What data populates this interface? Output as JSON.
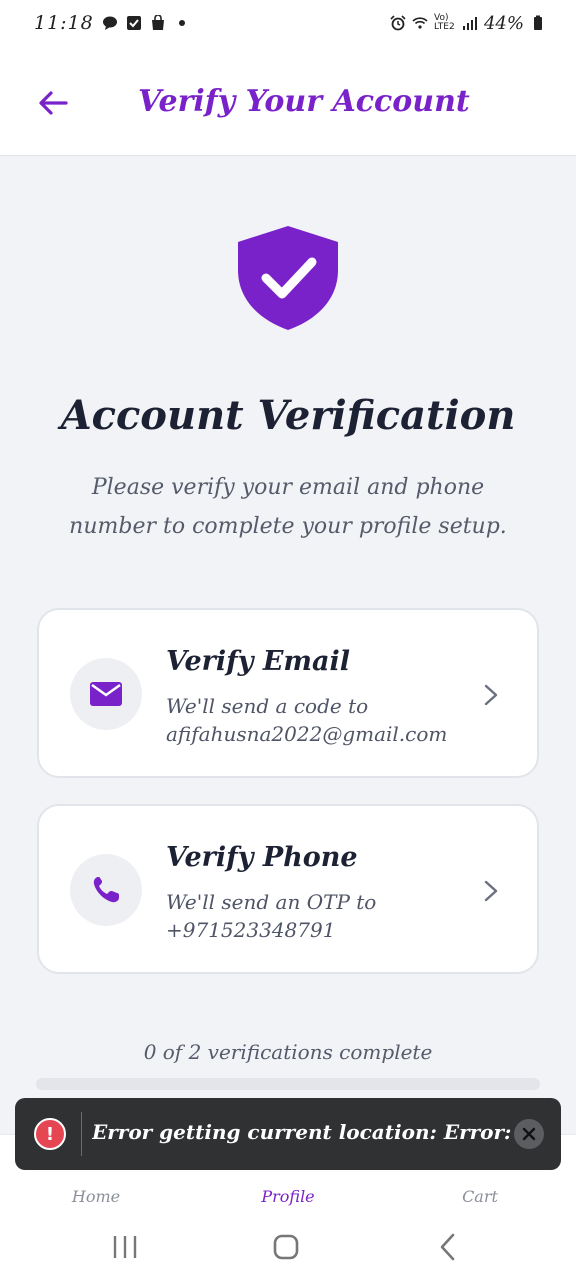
{
  "status_bar": {
    "time": "11:18",
    "network": "Vo) LTE2",
    "battery": "44%"
  },
  "header": {
    "title": "Verify Your Account"
  },
  "main": {
    "heading": "Account Verification",
    "description": "Please verify your email and phone number to complete your profile setup."
  },
  "cards": [
    {
      "title": "Verify Email",
      "line1": "We'll send a code to",
      "line2": "afifahusna2022@gmail.com",
      "icon": "mail-icon"
    },
    {
      "title": "Verify Phone",
      "line1": "We'll send an OTP to",
      "line2": "+971523348791",
      "icon": "phone-icon"
    }
  ],
  "progress": {
    "label": "0 of 2 verifications complete",
    "fraction": 0
  },
  "bottom_nav": {
    "items": [
      {
        "label": "Home"
      },
      {
        "label": "Profile"
      },
      {
        "label": "Cart"
      }
    ]
  },
  "toast": {
    "message": "Error getting current location: Error: ..."
  },
  "colors": {
    "accent": "#7a22c9",
    "background": "#f2f3f6",
    "toast_bg": "#2f3133",
    "error": "#e64552"
  }
}
